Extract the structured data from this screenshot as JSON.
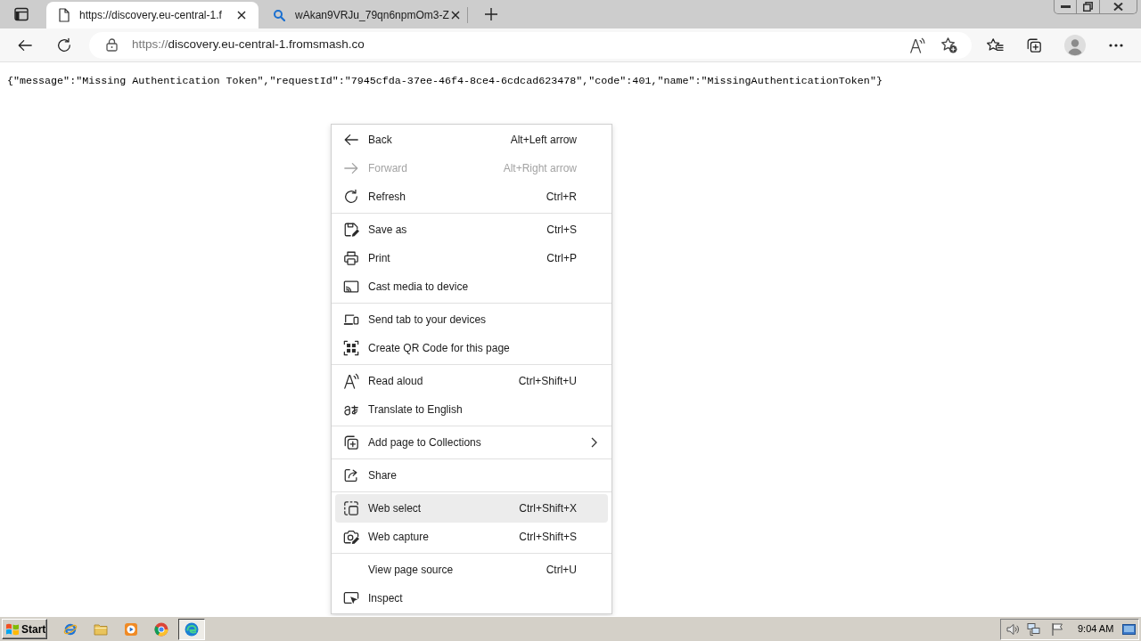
{
  "tabs": [
    {
      "kind": "page",
      "title": "https://discovery.eu-central-1.f",
      "selected": true
    },
    {
      "kind": "search",
      "title": "wAkan9VRJu_79qn6npmOm3-Z",
      "selected": false
    }
  ],
  "address_bar": {
    "scheme": "https://",
    "host": "discovery.eu-central-1.fromsmash.co"
  },
  "page": {
    "text": "{\"message\":\"Missing Authentication Token\",\"requestId\":\"7945cfda-37ee-46f4-8ce4-6cdcad623478\",\"code\":401,\"name\":\"MissingAuthenticationToken\"}"
  },
  "context_menu": {
    "groups": [
      [
        {
          "label": "Back",
          "shortcut": "Alt+Left arrow",
          "disabled": false,
          "highlighted": false,
          "submenu": false
        },
        {
          "label": "Forward",
          "shortcut": "Alt+Right arrow",
          "disabled": true,
          "highlighted": false,
          "submenu": false
        },
        {
          "label": "Refresh",
          "shortcut": "Ctrl+R",
          "disabled": false,
          "highlighted": false,
          "submenu": false
        }
      ],
      [
        {
          "label": "Save as",
          "shortcut": "Ctrl+S",
          "disabled": false,
          "highlighted": false,
          "submenu": false
        },
        {
          "label": "Print",
          "shortcut": "Ctrl+P",
          "disabled": false,
          "highlighted": false,
          "submenu": false
        },
        {
          "label": "Cast media to device",
          "disabled": false,
          "highlighted": false,
          "submenu": false
        }
      ],
      [
        {
          "label": "Send tab to your devices",
          "disabled": false,
          "highlighted": false,
          "submenu": false
        },
        {
          "label": "Create QR Code for this page",
          "disabled": false,
          "highlighted": false,
          "submenu": false
        }
      ],
      [
        {
          "label": "Read aloud",
          "shortcut": "Ctrl+Shift+U",
          "disabled": false,
          "highlighted": false,
          "submenu": false
        },
        {
          "label": "Translate to English",
          "disabled": false,
          "highlighted": false,
          "submenu": false
        }
      ],
      [
        {
          "label": "Add page to Collections",
          "disabled": false,
          "highlighted": false,
          "submenu": true
        }
      ],
      [
        {
          "label": "Share",
          "disabled": false,
          "highlighted": false,
          "submenu": false
        }
      ],
      [
        {
          "label": "Web select",
          "shortcut": "Ctrl+Shift+X",
          "disabled": false,
          "highlighted": true,
          "submenu": false
        },
        {
          "label": "Web capture",
          "shortcut": "Ctrl+Shift+S",
          "disabled": false,
          "highlighted": false,
          "submenu": false
        }
      ],
      [
        {
          "label": "View page source",
          "shortcut": "Ctrl+U",
          "disabled": false,
          "highlighted": false,
          "submenu": false
        },
        {
          "label": "Inspect",
          "disabled": false,
          "highlighted": false,
          "submenu": false
        }
      ]
    ]
  },
  "taskbar": {
    "start": "Start",
    "apps": [
      {
        "selected": false
      },
      {
        "selected": false
      },
      {
        "selected": false
      },
      {
        "selected": false
      },
      {
        "selected": true
      }
    ],
    "clock": "9:04 AM"
  }
}
